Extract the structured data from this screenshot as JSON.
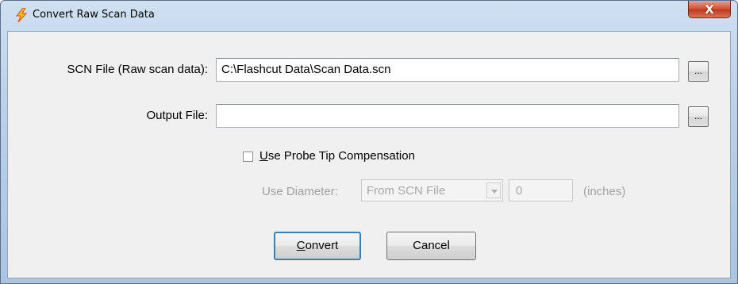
{
  "window": {
    "title": "Convert Raw Scan Data",
    "close_label": "X"
  },
  "form": {
    "scn_label": "SCN File (Raw scan data):",
    "scn_value": "C:\\Flashcut Data\\Scan Data.scn",
    "output_label": "Output File:",
    "output_value": "",
    "browse_label": "...",
    "probe_checkbox_rest": "se Probe Tip Compensation",
    "probe_checkbox_mnemonic": "U",
    "probe_checkbox_checked": false,
    "diameter_label": "Use Diameter:",
    "diameter_source_selected": "From SCN File",
    "diameter_value": "0",
    "diameter_unit": "(inches)"
  },
  "buttons": {
    "convert_mnemonic": "C",
    "convert_rest": "onvert",
    "cancel": "Cancel"
  },
  "icons": {
    "app": "lightning-bolt-icon",
    "close": "close-icon",
    "dropdown": "chevron-down-icon"
  },
  "colors": {
    "app_icon_yellow": "#f5c400",
    "app_icon_red": "#e04a10",
    "close_red": "#c0391c",
    "default_button_border": "#3c7fb1"
  }
}
